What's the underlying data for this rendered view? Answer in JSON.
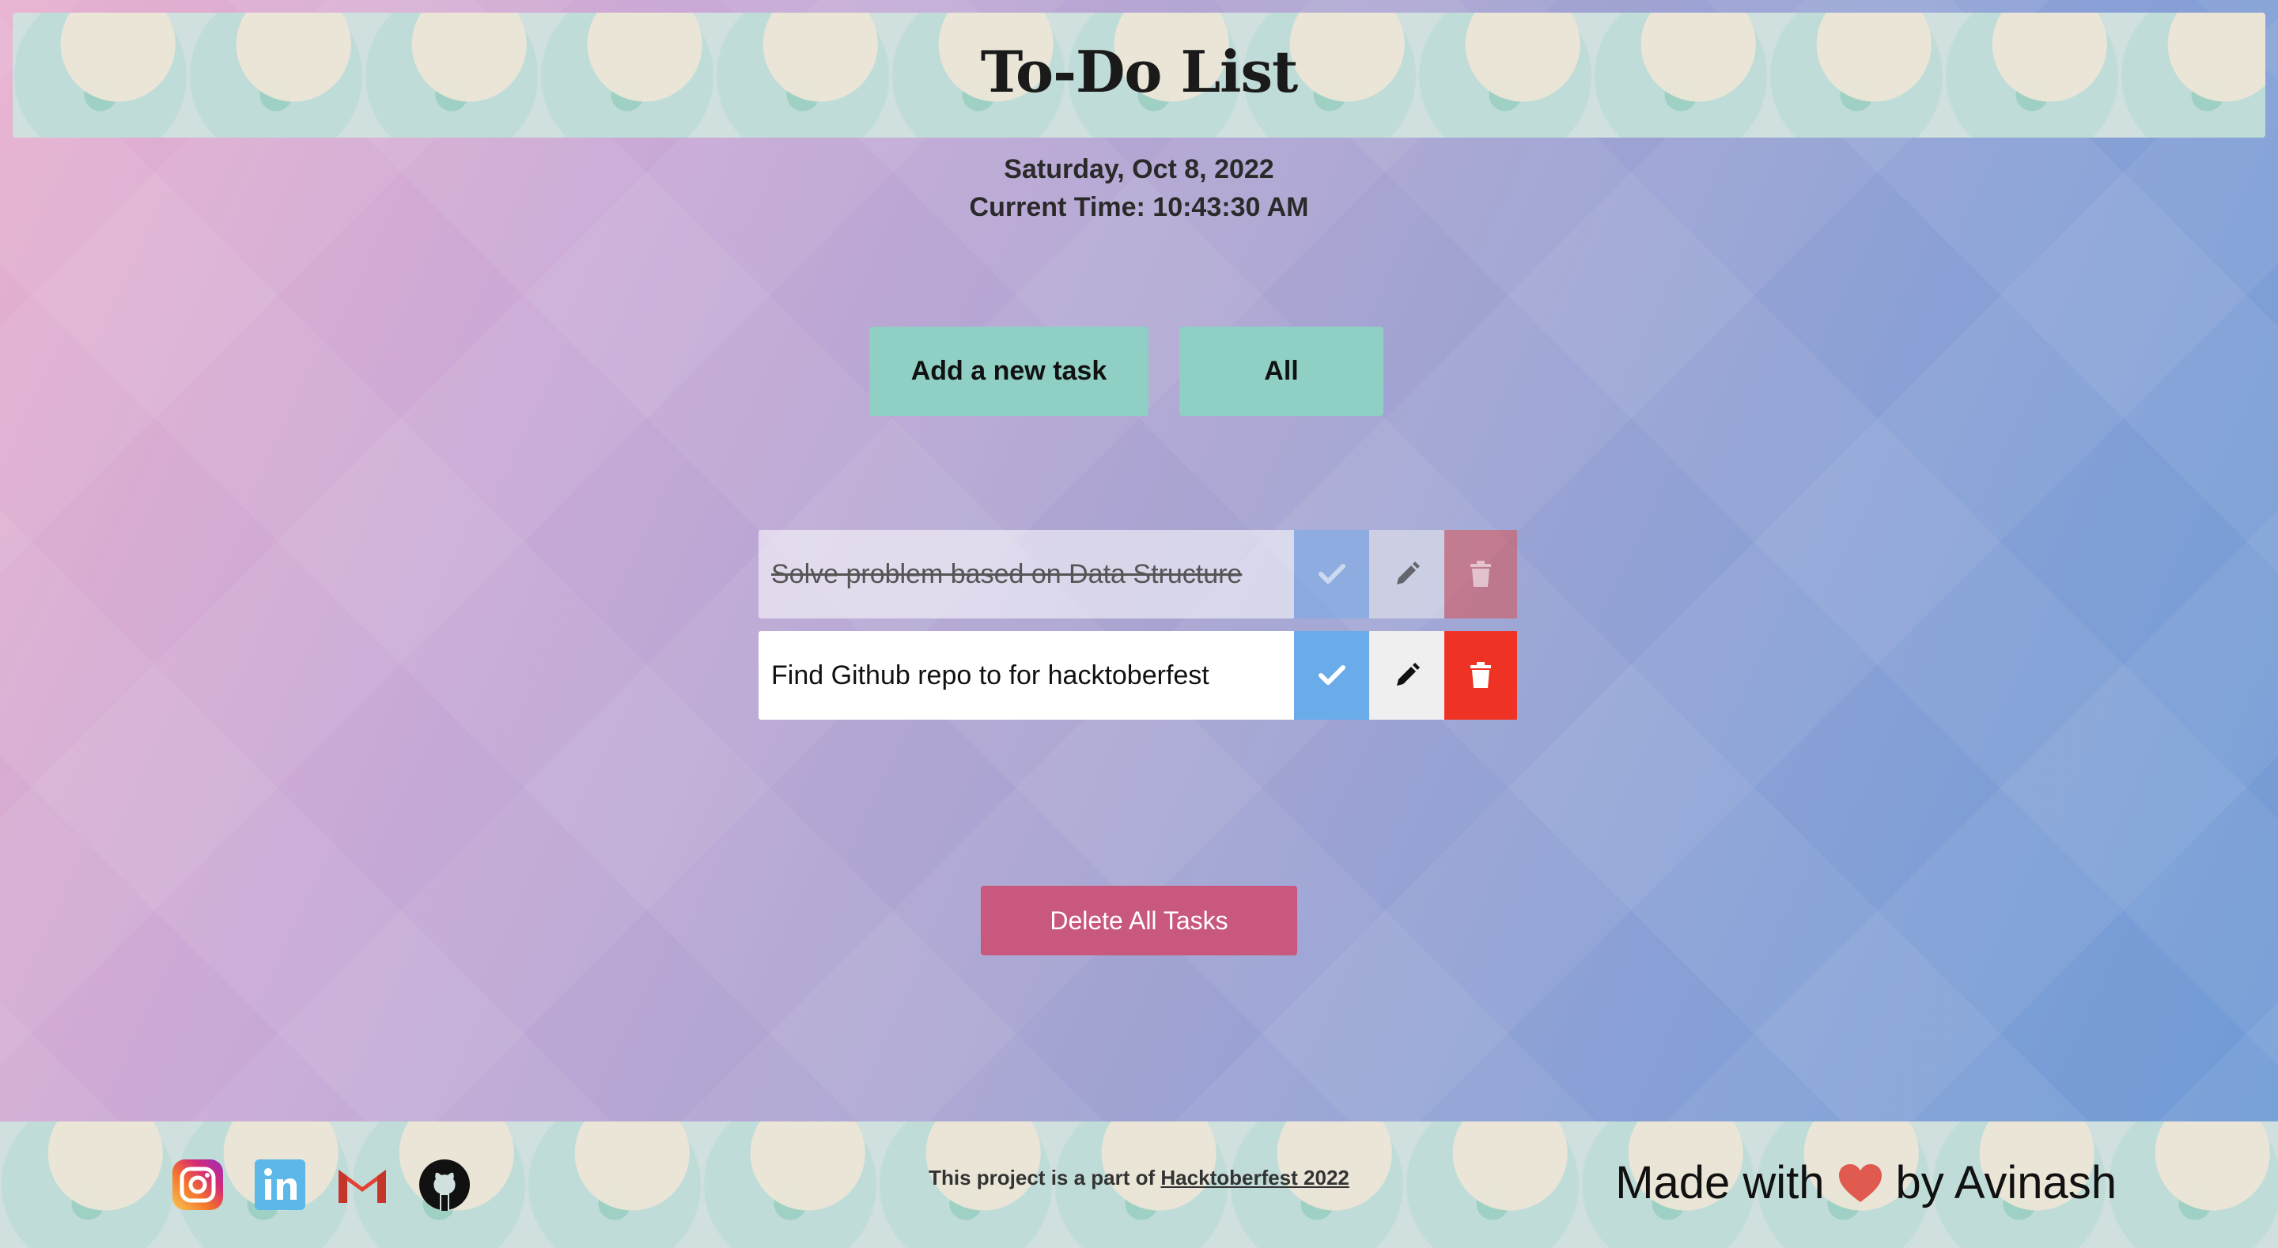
{
  "header": {
    "title": "To-Do List"
  },
  "datetime": {
    "date": "Saturday, Oct 8, 2022",
    "time": "Current Time: 10:43:30 AM"
  },
  "controls": {
    "add_label": "Add a new task",
    "filter_label": "All"
  },
  "tasks": [
    {
      "text": "Solve problem based on Data Structure",
      "completed": true
    },
    {
      "text": "Find Github repo to for hacktoberfest",
      "completed": false
    }
  ],
  "delete_all_label": "Delete All Tasks",
  "footer": {
    "credit_prefix": "This project is a part of",
    "credit_link": "Hacktoberfest 2022",
    "made_prefix": "Made with",
    "made_suffix": "by Avinash",
    "social_icons": [
      "instagram-icon",
      "linkedin-icon",
      "gmail-icon",
      "github-icon"
    ]
  },
  "colors": {
    "accent_button": "#8fcfc4",
    "check": "#6aabea",
    "delete": "#ee3223",
    "delete_all": "#c9587e",
    "heart": "#e05a4f"
  }
}
